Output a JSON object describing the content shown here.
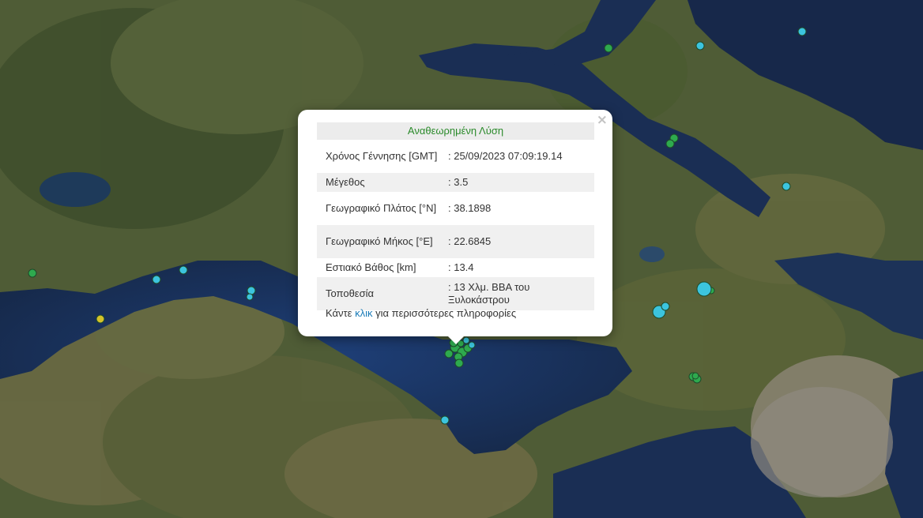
{
  "popup": {
    "title": "Αναθεωρημένη Λύση",
    "close_label": "×",
    "rows": [
      {
        "label": "Χρόνος Γέννησης [GMT]",
        "value": ": 25/09/2023 07:09:19.14"
      },
      {
        "label": "Μέγεθος",
        "value": ": 3.5"
      },
      {
        "label": "Γεωγραφικό Πλάτος [°N]",
        "value": ": 38.1898"
      },
      {
        "label": "Γεωγραφικό Μήκος [°E]",
        "value": ": 22.6845"
      },
      {
        "label": "Εστιακό Βάθος [km]",
        "value": ": 13.4"
      },
      {
        "label": "Τοποθεσία",
        "value": ": 13 Χλμ. ΒΒΑ του Ξυλοκάστρου"
      }
    ],
    "more_prefix": "Κάντε",
    "more_link": "κλικ",
    "more_suffix": "για περισσότερες πληροφορίες"
  },
  "map": {
    "type": "satellite",
    "colors": {
      "sea": "#1b2e52",
      "land": "#4a5a34",
      "marker_green": "#2eaa4e",
      "marker_cyan": "#3cc4de",
      "marker_yellow": "#d4c22a"
    },
    "markers_green_count": 20,
    "markers_cyan_count": 21,
    "markers_yellow_count": 1
  }
}
